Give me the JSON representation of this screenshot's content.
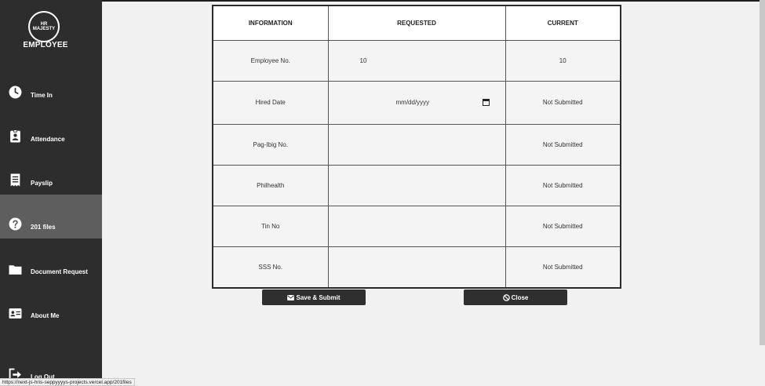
{
  "sidebar": {
    "logo_text": "HR\nMAJESTY",
    "brand": "EMPLOYEE",
    "items": [
      {
        "label": "Time In",
        "icon": "clock-icon"
      },
      {
        "label": "Attendance",
        "icon": "id-badge-icon"
      },
      {
        "label": "Payslip",
        "icon": "receipt-icon"
      },
      {
        "label": "201 files",
        "icon": "question-circle-icon",
        "active": true
      },
      {
        "label": "Document Request",
        "icon": "folder-icon"
      },
      {
        "label": "About Me",
        "icon": "id-card-icon"
      },
      {
        "label": "Log Out",
        "icon": "logout-icon"
      }
    ]
  },
  "table": {
    "headers": [
      "INFORMATION",
      "REQUESTED",
      "CURRENT"
    ],
    "rows": [
      {
        "info": "Employee No.",
        "requested": "10",
        "current": "10"
      },
      {
        "info": "Hired Date",
        "requested": "mm/dd/yyyy",
        "current": "Not Submitted"
      },
      {
        "info": "Pag-Ibig No.",
        "requested": "",
        "current": "Not Submitted"
      },
      {
        "info": "Philhealth",
        "requested": "",
        "current": "Not Submitted"
      },
      {
        "info": "Tin No",
        "requested": "",
        "current": "Not Submitted"
      },
      {
        "info": "SSS No.",
        "requested": "",
        "current": "Not Submitted"
      }
    ]
  },
  "buttons": {
    "save_label": "Save & Submit",
    "close_label": "Close"
  },
  "status_url": "https://next-js-hris-seppyyyys-projects.vercel.app/201files"
}
